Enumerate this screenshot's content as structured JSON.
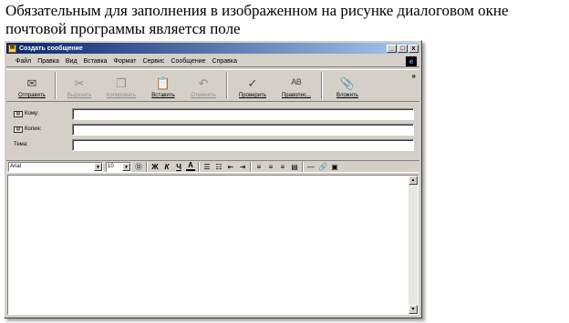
{
  "question": "Обязательным для заполнения в изображенном на рисунке диалоговом окне почтовой программы является поле",
  "window": {
    "title": "Создать сообщение",
    "controls": {
      "minimize": "_",
      "maximize": "□",
      "close": "x"
    }
  },
  "menu": [
    "Файл",
    "Правка",
    "Вид",
    "Вставка",
    "Формат",
    "Сервис",
    "Сообщение",
    "Справка"
  ],
  "toolbar": [
    {
      "label": "Отправить",
      "icon": "send-icon",
      "glyph": "✉",
      "disabled": false
    },
    {
      "label": "Вырезать",
      "icon": "cut-icon",
      "glyph": "✂",
      "disabled": true
    },
    {
      "label": "Копировать",
      "icon": "copy-icon",
      "glyph": "❐",
      "disabled": true
    },
    {
      "label": "Вставить",
      "icon": "paste-icon",
      "glyph": "📋",
      "disabled": false
    },
    {
      "label": "Отменить",
      "icon": "undo-icon",
      "glyph": "↶",
      "disabled": true
    },
    {
      "label": "Проверить",
      "icon": "check-names-icon",
      "glyph": "✓",
      "disabled": false
    },
    {
      "label": "Правопис...",
      "icon": "spelling-icon",
      "glyph": "ᴬᴮ",
      "disabled": false
    },
    {
      "label": "Вложить",
      "icon": "attach-icon",
      "glyph": "📎",
      "disabled": false
    }
  ],
  "fields": {
    "to": {
      "label": "Кому:",
      "value": ""
    },
    "cc": {
      "label": "Копия:",
      "value": ""
    },
    "subject": {
      "label": "Тема:",
      "value": ""
    }
  },
  "format": {
    "font": "Arial",
    "size": "10",
    "buttons": [
      "Ж",
      "К",
      "Ч",
      "А"
    ]
  },
  "body_text": ""
}
